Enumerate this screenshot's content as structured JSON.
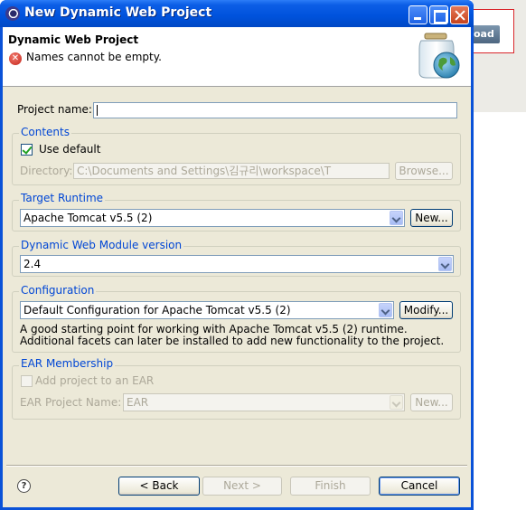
{
  "background_app": {
    "button_label": "oad"
  },
  "window": {
    "title": "New Dynamic Web Project"
  },
  "banner": {
    "title": "Dynamic Web Project",
    "message": "Names cannot be empty."
  },
  "project_name": {
    "label": "Project name:",
    "value": ""
  },
  "contents": {
    "title": "Contents",
    "use_default_label": "Use default",
    "use_default_checked": true,
    "directory_label": "Directory:",
    "directory_value": "C:\\Documents and Settings\\김규리\\workspace\\T",
    "browse_label": "Browse..."
  },
  "target_runtime": {
    "title": "Target Runtime",
    "selected": "Apache Tomcat v5.5 (2)",
    "new_label": "New..."
  },
  "module_version": {
    "title": "Dynamic Web Module version",
    "selected": "2.4"
  },
  "configuration": {
    "title": "Configuration",
    "selected": "Default Configuration for Apache Tomcat v5.5 (2)",
    "modify_label": "Modify...",
    "description": "A good starting point for working with Apache Tomcat v5.5 (2) runtime. Additional facets can later be installed to add new functionality to the project."
  },
  "ear": {
    "title": "EAR Membership",
    "add_label": "Add project to an EAR",
    "add_checked": false,
    "project_name_label": "EAR Project Name:",
    "project_name_value": "EAR",
    "new_label": "New..."
  },
  "buttons": {
    "help": "?",
    "back": "< Back",
    "next": "Next >",
    "finish": "Finish",
    "cancel": "Cancel"
  }
}
